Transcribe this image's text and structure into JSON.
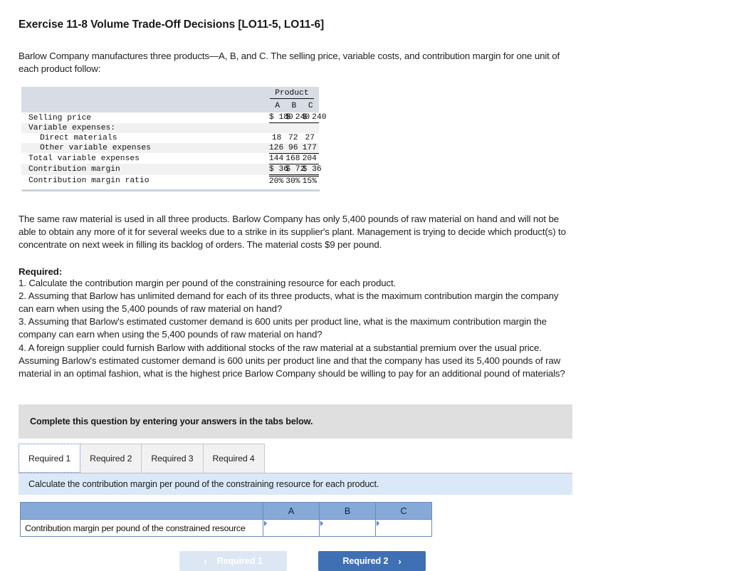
{
  "exercise": {
    "title": "Exercise 11-8 Volume Trade-Off Decisions [LO11-5, LO11-6]",
    "intro_p1": "Barlow Company manufactures three products—A, B, and C. The selling price, variable costs, and contribution margin for one unit of",
    "intro_p2": "each product follow:",
    "rawmat_l1": "The same raw material is used in all three products. Barlow Company has only 5,400 pounds of raw material on hand and will not be",
    "rawmat_l2": "able to obtain any more of it for several weeks due to a strike in its supplier's plant. Management is trying to decide which product(s) to",
    "rawmat_l3": "concentrate on next week in filling its backlog of orders. The material costs $9 per pound."
  },
  "required": {
    "heading": "Required:",
    "items": [
      "1. Calculate the contribution margin per pound of the constraining resource for each product.",
      "2. Assuming that Barlow has unlimited demand for each of its three products, what is the maximum contribution margin the company",
      "can earn when using the 5,400 pounds of raw material on hand?",
      "3. Assuming that Barlow's estimated customer demand is 600 units per product line, what is the maximum contribution margin the",
      "company can earn when using the 5,400 pounds of raw material on hand?",
      "4. A foreign supplier could furnish Barlow with additional stocks of the raw material at a substantial premium over the usual price.",
      "Assuming Barlow's estimated customer demand is 600 units per product line and that the company has used its 5,400 pounds of raw",
      "material in an optimal fashion, what is the highest price Barlow Company should be willing to pay for an additional pound of materials?"
    ]
  },
  "data_table": {
    "group_header": "Product",
    "columns": [
      "A",
      "B",
      "C"
    ],
    "rows": [
      {
        "label": "Selling price",
        "values": [
          "$ 180",
          "$ 240",
          "$ 240"
        ],
        "style": "money-underline"
      },
      {
        "label": "Variable expenses:",
        "values": [
          "",
          "",
          ""
        ],
        "style": "plain"
      },
      {
        "label": "Direct materials",
        "values": [
          "18",
          "72",
          "27"
        ],
        "style": "indent"
      },
      {
        "label": "Other variable expenses",
        "values": [
          "126",
          "96",
          "177"
        ],
        "style": "indent-underline"
      },
      {
        "label": "Total variable expenses",
        "values": [
          "144",
          "168",
          "204"
        ],
        "style": "underline"
      },
      {
        "label": "Contribution margin",
        "values": [
          "$  36",
          "$  72",
          "$  36"
        ],
        "style": "money-double"
      },
      {
        "label": "Contribution margin ratio",
        "values": [
          "20%",
          "30%",
          "15%"
        ],
        "style": "plain"
      }
    ]
  },
  "banner": {
    "grey_text": "Complete this question by entering your answers in the tabs below."
  },
  "tabs": [
    {
      "label": "Required 1",
      "active": true
    },
    {
      "label": "Required 2",
      "active": false
    },
    {
      "label": "Required 3",
      "active": false
    },
    {
      "label": "Required 4",
      "active": false
    }
  ],
  "blue_bar": {
    "text": "Calculate the contribution margin per pound of the constraining resource for each product."
  },
  "answer_table": {
    "blank_header": "",
    "columns": [
      "A",
      "B",
      "C"
    ],
    "row_label": "Contribution margin per pound of the constrained resource",
    "values": [
      "",
      "",
      ""
    ]
  },
  "nav": {
    "prev_label": "Required 1",
    "prev_icon": "chevron-left-icon",
    "prev_chevron": "‹",
    "next_label": "Required 2",
    "next_icon": "chevron-right-icon",
    "next_chevron": "›"
  },
  "colors": {
    "accent_blue": "#3f70b4",
    "table_header_blue": "#86a9d8",
    "light_blue_bar": "#dbe8f7",
    "grey_banner": "#dfdfdf",
    "data_header_grey": "#d8dce4"
  }
}
